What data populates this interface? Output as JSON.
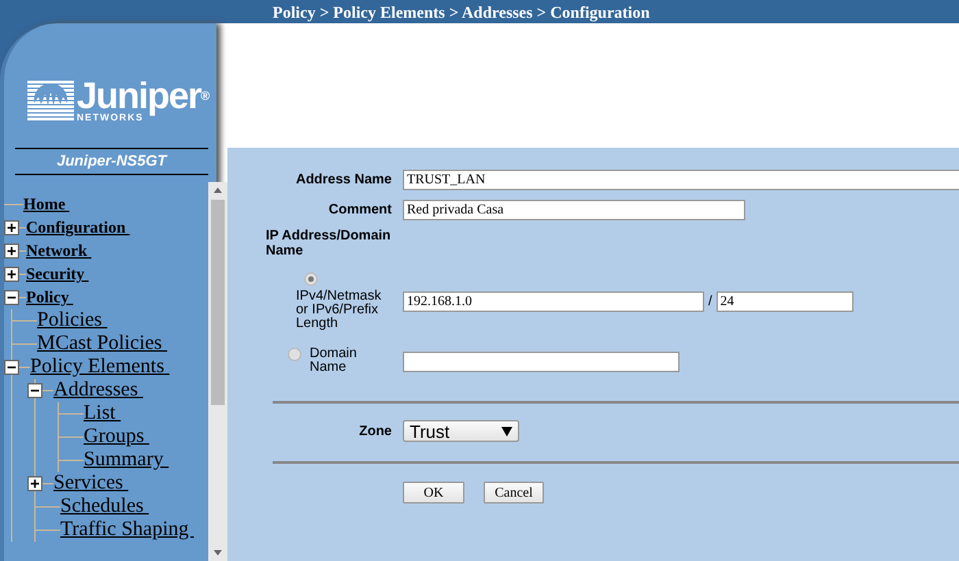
{
  "breadcrumb": "Policy > Policy Elements > Addresses > Configuration",
  "logo": {
    "name": "Juniper",
    "registered": "®",
    "sub": "NETWORKS"
  },
  "device": "Juniper-NS5GT",
  "tree": [
    {
      "label": "Home",
      "kind": "leaf"
    },
    {
      "label": "Configuration",
      "kind": "folder",
      "expanded": false
    },
    {
      "label": "Network",
      "kind": "folder",
      "expanded": false
    },
    {
      "label": "Security",
      "kind": "folder",
      "expanded": false
    },
    {
      "label": "Policy",
      "kind": "folder",
      "expanded": true,
      "children": [
        {
          "label": "Policies",
          "kind": "leaf"
        },
        {
          "label": "MCast Policies",
          "kind": "leaf"
        },
        {
          "label": "Policy Elements",
          "kind": "folder",
          "expanded": true,
          "children": [
            {
              "label": "Addresses",
              "kind": "folder",
              "expanded": true,
              "children": [
                {
                  "label": "List",
                  "kind": "leaf"
                },
                {
                  "label": "Groups",
                  "kind": "leaf"
                },
                {
                  "label": "Summary",
                  "kind": "leaf"
                }
              ]
            },
            {
              "label": "Services",
              "kind": "folder",
              "expanded": false
            },
            {
              "label": "Schedules",
              "kind": "leaf"
            },
            {
              "label": "Traffic Shaping",
              "kind": "leaf"
            }
          ]
        }
      ]
    }
  ],
  "form": {
    "address_name": {
      "label": "Address Name",
      "value": "TRUST_LAN"
    },
    "comment": {
      "label": "Comment",
      "value": "Red privada Casa"
    },
    "ip_heading": "IP Address/Domain Name",
    "options": [
      {
        "kind": "ip",
        "label": "IPv4/Netmask or IPv6/Prefix Length",
        "selected": true,
        "value": "192.168.1.0",
        "separator": "/",
        "prefix": "24"
      },
      {
        "kind": "domain",
        "label": "Domain Name",
        "selected": false
      }
    ],
    "zone": {
      "label": "Zone",
      "value": "Trust"
    },
    "buttons": [
      "OK",
      "Cancel"
    ]
  }
}
